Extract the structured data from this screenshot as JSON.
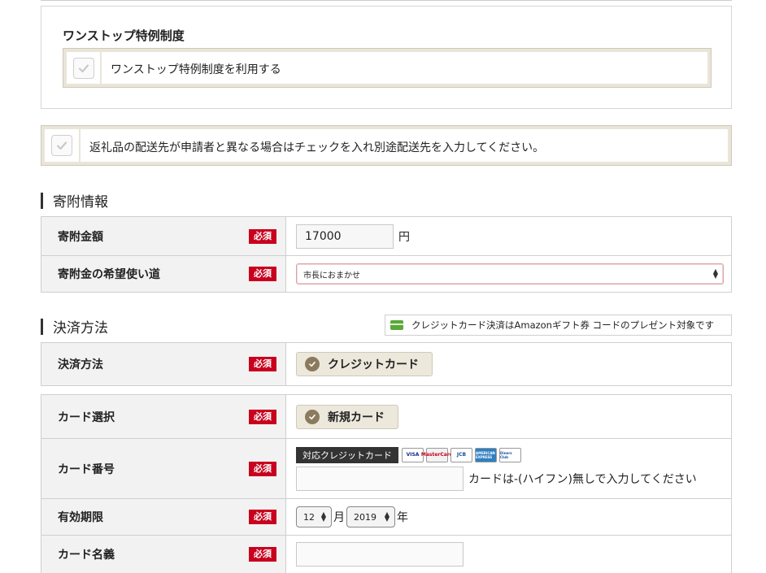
{
  "onestop": {
    "title": "ワンストップ特例制度",
    "checkbox_label": "ワンストップ特例制度を利用する"
  },
  "shipping": {
    "checkbox_label": "返礼品の配送先が申請者と異なる場合はチェックを入れ別途配送先を入力してください。"
  },
  "donation": {
    "heading": "寄附情報",
    "amount_label": "寄附金額",
    "amount_value": "17000",
    "amount_unit": "円",
    "usage_label": "寄附金の希望使い道",
    "usage_selected": "市長におまかせ",
    "required": "必須"
  },
  "payment": {
    "heading": "決済方法",
    "amazon_note": "クレジットカード決済はAmazonギフト券 コードのプレゼント対象です",
    "method_label": "決済方法",
    "method_value": "クレジットカード",
    "card_select_label": "カード選択",
    "card_select_value": "新規カード",
    "card_number_label": "カード番号",
    "card_banner_label": "対応クレジットカード",
    "card_logos": [
      "VISA",
      "MasterCard",
      "JCB",
      "AMERICAN EXPRESS",
      "Diners Club"
    ],
    "card_number_hint": "カードは-(ハイフン)無しで入力してください",
    "expiry_label": "有効期限",
    "expiry_month": "12",
    "expiry_month_unit": "月",
    "expiry_year": "2019",
    "expiry_year_unit": "年",
    "card_name_label": "カード名義",
    "required": "必須"
  },
  "colors": {
    "required_badge": "#c8001e",
    "frame_beige": "#e9e5d9",
    "pill_bg": "#ede8dc",
    "header_cell_bg": "#f2f2f2"
  }
}
